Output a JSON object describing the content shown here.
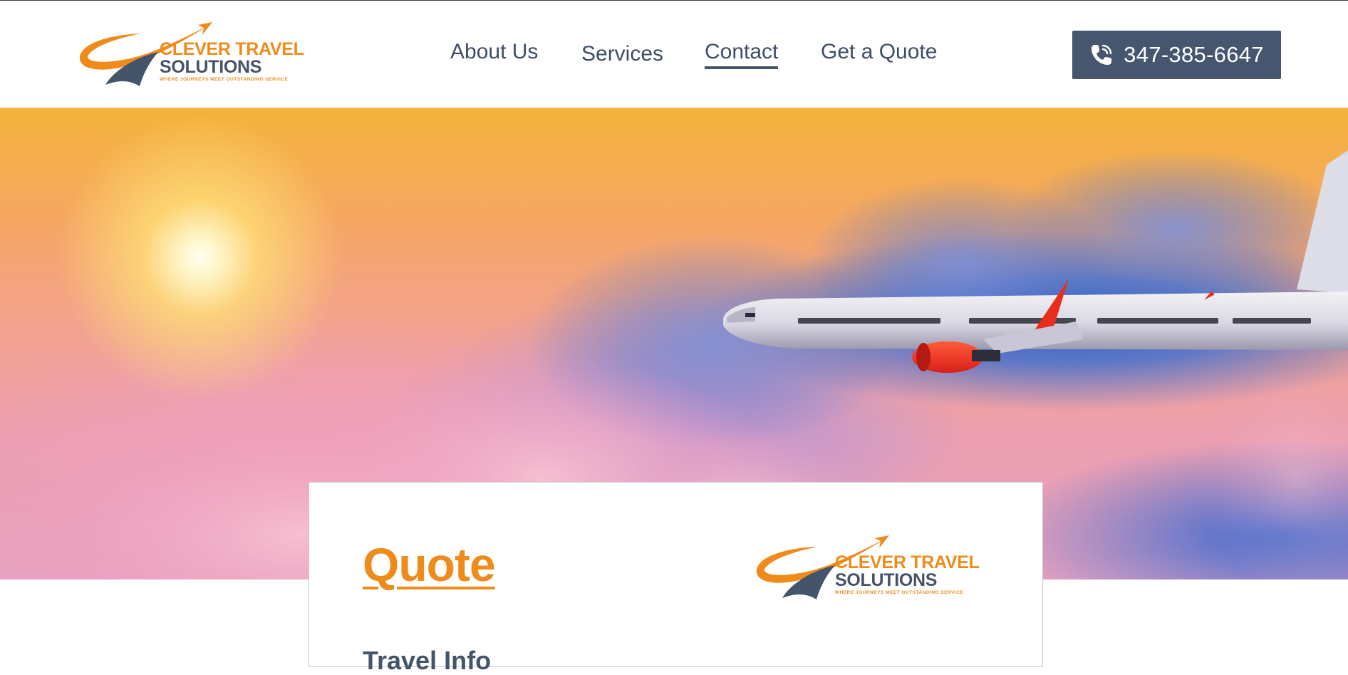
{
  "brand": {
    "name_line1": "CLEVER TRAVEL",
    "name_line2": "SOLUTIONS",
    "tagline": "WHERE JOURNEYS MEET OUTSTANDING SERVICE",
    "logo_icon": "orbit-plane-logo-icon",
    "colors": {
      "orange": "#ee8b1b",
      "slate": "#44546b"
    }
  },
  "nav": {
    "items": [
      {
        "label": "About Us"
      },
      {
        "label": "Services"
      },
      {
        "label": "Contact",
        "active": true
      },
      {
        "label": "Get a Quote"
      }
    ]
  },
  "phone": {
    "icon": "phone-icon",
    "number": "347-385-6647",
    "button_color": "#46566f"
  },
  "hero": {
    "image": "airplane-above-sunset-clouds"
  },
  "card": {
    "title": "Quote",
    "section_heading": "Travel Info"
  }
}
